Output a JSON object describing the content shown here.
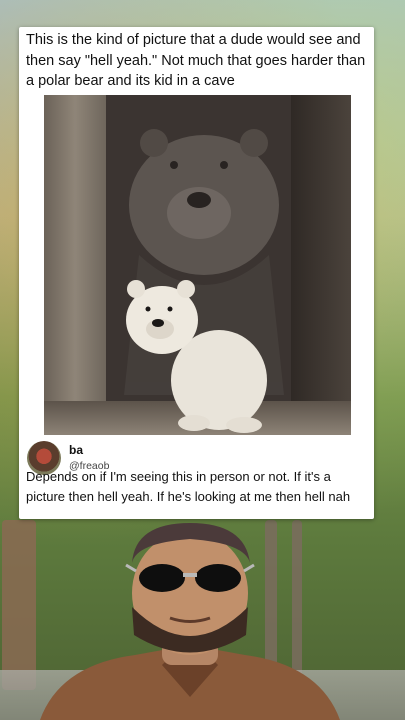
{
  "post": {
    "text": "This is the kind of picture that a dude would see and then say \"hell yeah.\" Not much that goes harder than a polar bear and its kid in a cave"
  },
  "reply": {
    "user_name": "ba",
    "user_handle": "@freaob",
    "text": "Depends on if I'm seeing this in person or not. If it's a picture then hell yeah. If he's looking at me then hell nah"
  },
  "icons": {
    "avatar": "reply-user-avatar",
    "bear_photo": "polar-bear-photo"
  },
  "colors": {
    "card_background": "#ffffff",
    "text": "#111111"
  }
}
